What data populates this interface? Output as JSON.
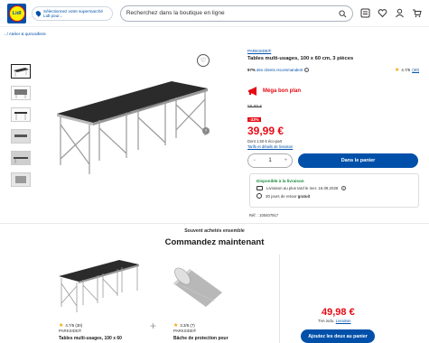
{
  "header": {
    "logo_text": "Lidl",
    "store_selector": "Sélectionnez votre supermarché Lidl pour...",
    "search_placeholder": "Recherchez dans la boutique en ligne"
  },
  "breadcrumb": ".../ Atelier & quincaillerie",
  "product": {
    "brand": "PARKSIDE®",
    "title": "Tables multi-usages, 100 x 60 cm, 3 pièces",
    "reco_percent": "97%",
    "reco_text": " des clients recommandent",
    "rating": "4.7/5",
    "rating_count": "(30)",
    "deal_label": "Méga bon plan",
    "old_price": "59.99 €",
    "discount": "-33%",
    "price": "39,99 €",
    "eco_text": "Dont 1,50 € éco-part",
    "eco_link": "Tarifs et détails de livraison",
    "quantity": "1",
    "add_to_cart": "Dans le panier"
  },
  "availability": {
    "title": "Disponible à la livraison",
    "delivery": "Livraison au plus tard le mer. 16.09.2026",
    "returns_prefix": "30 jours de retour ",
    "returns_bold": "gratuit"
  },
  "reference": "Réf. : 100407917",
  "bundle": {
    "subtitle": "Souvent achetés ensemble",
    "title": "Commandez maintenant",
    "item1": {
      "rating": "4.7/5 (30)",
      "brand": "PARKSIDE®",
      "title": "Tables multi-usages, 100 x 60"
    },
    "item2": {
      "rating": "3.3/5 (7)",
      "brand": "PARKSIDE®",
      "title": "Bâche de protection pour"
    },
    "price": "49,98 €",
    "tva_text": "TVA inclu. ",
    "tva_link": "Livraison",
    "button": "Ajoutez les deux au panier"
  },
  "colors": {
    "brand_blue": "#0050aa",
    "price_red": "#e60a14",
    "available_green": "#1a8a3a",
    "star": "#f0a500"
  }
}
